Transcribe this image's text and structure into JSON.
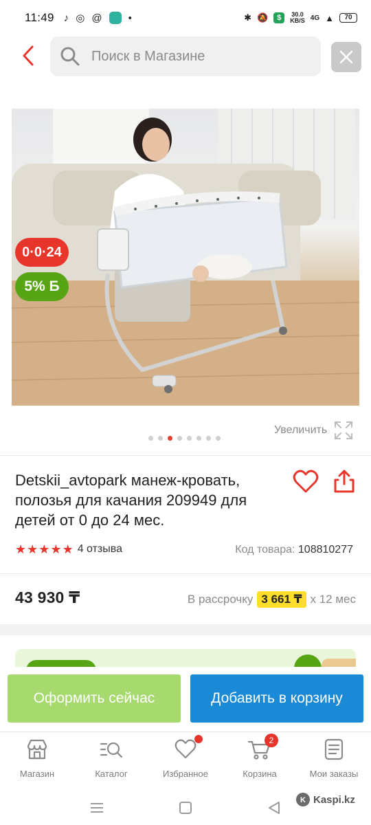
{
  "status_bar": {
    "time": "11:49",
    "net_speed_value": "30.0",
    "net_speed_unit": "KB/S",
    "network": "4G",
    "battery": "70"
  },
  "search": {
    "placeholder": "Поиск в Магазине"
  },
  "product": {
    "badge_installment": "0·0·24",
    "badge_bonus": "5% Б",
    "zoom_label": "Увеличить",
    "gallery_count": 8,
    "gallery_active_index": 3,
    "title": "Detskii_avtopark манеж-кровать, полозья для качания 209949 для детей от 0 до 24 мес.",
    "rating": 5,
    "reviews": "4 отзыва",
    "sku_label": "Код товара:",
    "sku": "108810277",
    "price": "43 930 ₸",
    "installment_prefix": "В рассрочку",
    "installment_amount": "3 661 ₸",
    "installment_suffix": "х 12 мес"
  },
  "actions": {
    "order_now": "Оформить сейчас",
    "add_to_cart": "Добавить в корзину"
  },
  "bottom_nav": {
    "items": [
      {
        "label": "Магазин",
        "icon": "store-icon"
      },
      {
        "label": "Каталог",
        "icon": "catalog-search-icon"
      },
      {
        "label": "Избранное",
        "icon": "heart-icon"
      },
      {
        "label": "Корзина",
        "icon": "cart-icon",
        "count": "2"
      },
      {
        "label": "Мои заказы",
        "icon": "orders-icon"
      }
    ]
  },
  "watermark": "Kaspi.kz",
  "colors": {
    "accent_red": "#e8352b",
    "green": "#57a515",
    "order_button": "#a6da6e",
    "cart_button": "#1a8ad6",
    "installment_highlight": "#ffde2b"
  }
}
